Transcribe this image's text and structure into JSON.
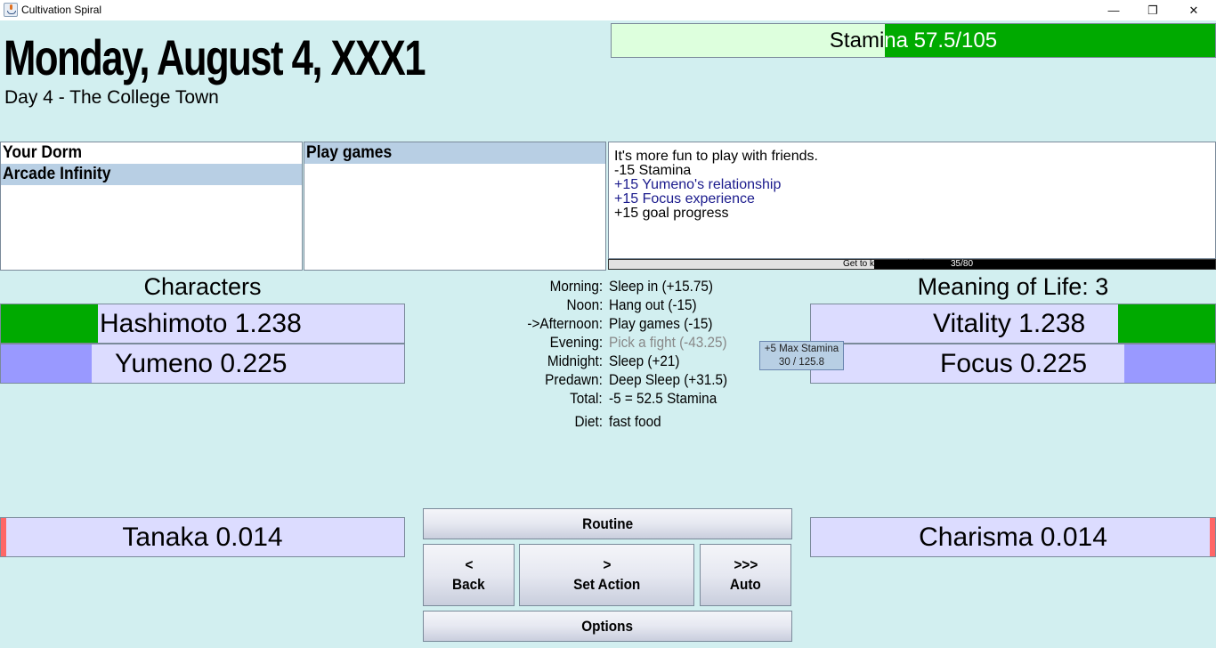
{
  "window": {
    "title": "Cultivation Spiral",
    "icon": "java-cup-icon",
    "controls": {
      "minimize": "—",
      "maximize": "❐",
      "close": "✕"
    }
  },
  "header": {
    "date": "Monday, August 4, XXX1",
    "subtitle": "Day 4 - The College Town"
  },
  "stamina": {
    "label": "Stamina 57.5/105",
    "current": 57.5,
    "max": 105,
    "fill_color": "#00aa00",
    "bg_color": "#ddffdd"
  },
  "locations": {
    "items": [
      {
        "label": "Your Dorm",
        "selected": false
      },
      {
        "label": "Arcade Infinity",
        "selected": true
      }
    ]
  },
  "actions": {
    "items": [
      {
        "label": "Play games",
        "selected": true
      }
    ]
  },
  "description": {
    "lines": [
      {
        "text": "It's more fun to play with friends.",
        "style": "normal"
      },
      {
        "text": "-15 Stamina",
        "style": "normal"
      },
      {
        "text": "+15 Yumeno's relationship",
        "style": "blue"
      },
      {
        "text": "+15 Focus experience",
        "style": "blue"
      },
      {
        "text": "+15 goal progress",
        "style": "normal"
      }
    ]
  },
  "goal": {
    "label": "Get to know each other:",
    "value_text": "35/80",
    "current": 35,
    "max": 80
  },
  "characters": {
    "heading": "Characters",
    "items": [
      {
        "label": "Hashimoto 1.238",
        "value": 1.238,
        "fill": 0.24,
        "color": "#00aa00"
      },
      {
        "label": "Yumeno 0.225",
        "value": 0.225,
        "fill": 0.226,
        "color": "#9999ff"
      },
      {
        "label": "Tanaka 0.014",
        "value": 0.014,
        "fill": 0.014,
        "color": "#ff6666"
      }
    ]
  },
  "meaning_of_life": {
    "heading": "Meaning of Life: 3",
    "stats": [
      {
        "label": "Vitality 1.238",
        "value": 1.238,
        "fill": 0.24,
        "color": "#00aa00"
      },
      {
        "label": "Focus 0.225",
        "value": 0.225,
        "fill": 0.225,
        "color": "#9999ff"
      },
      {
        "label": "Charisma 0.014",
        "value": 0.014,
        "fill": 0.014,
        "color": "#ff6666"
      }
    ]
  },
  "schedule": {
    "rows": [
      {
        "label": "Morning:",
        "value": "Sleep in (+15.75)",
        "muted": false
      },
      {
        "label": "Noon:",
        "value": "Hang out (-15)",
        "muted": false
      },
      {
        "label": "->Afternoon:",
        "value": "Play games (-15)",
        "muted": false
      },
      {
        "label": "Evening:",
        "value": "Pick a fight (-43.25)",
        "muted": true
      },
      {
        "label": "Midnight:",
        "value": "Sleep (+21)",
        "muted": false
      },
      {
        "label": "Predawn:",
        "value": "Deep Sleep (+31.5)",
        "muted": false
      },
      {
        "label": "Total:",
        "value": "-5 = 52.5 Stamina",
        "muted": false
      }
    ],
    "diet_label": "Diet:",
    "diet_value": "fast food"
  },
  "tooltip": {
    "line1": "+5 Max Stamina",
    "line2": "30 / 125.8"
  },
  "buttons": {
    "routine": "Routine",
    "back_symbol": "<",
    "back": "Back",
    "set_symbol": ">",
    "set": "Set Action",
    "auto_symbol": ">>>",
    "auto": "Auto",
    "options": "Options"
  }
}
